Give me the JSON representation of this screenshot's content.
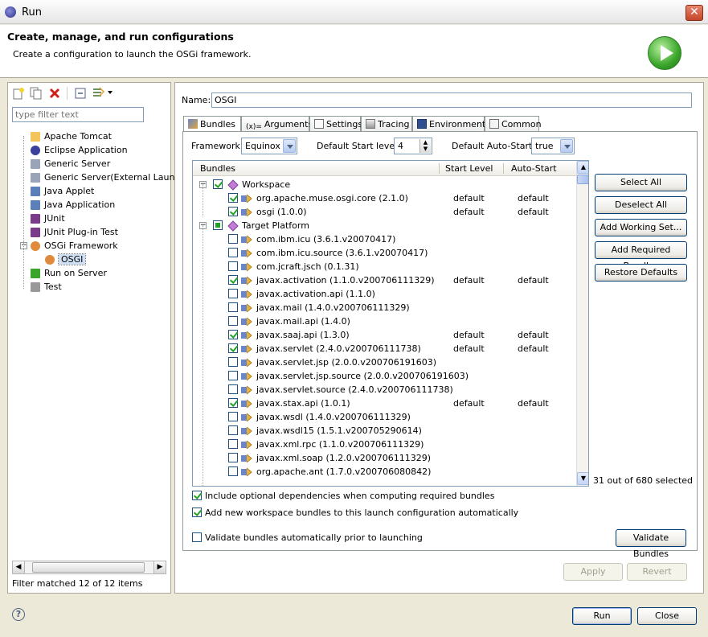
{
  "window": {
    "title": "Run",
    "close_glyph": "✕"
  },
  "header": {
    "title": "Create, manage, and run configurations",
    "description": "Create a configuration to launch the OSGi framework."
  },
  "left": {
    "filter_placeholder": "type filter text",
    "tree": [
      {
        "label": "Apache Tomcat",
        "icon": "tomcat-icon"
      },
      {
        "label": "Eclipse Application",
        "icon": "eclipse-icon"
      },
      {
        "label": "Generic Server",
        "icon": "server-icon"
      },
      {
        "label": "Generic Server(External Launch)",
        "icon": "server-icon"
      },
      {
        "label": "Java Applet",
        "icon": "applet-icon"
      },
      {
        "label": "Java Application",
        "icon": "java-app-icon"
      },
      {
        "label": "JUnit",
        "icon": "junit-icon"
      },
      {
        "label": "JUnit Plug-in Test",
        "icon": "junit-plugin-icon"
      },
      {
        "label": "OSGi Framework",
        "icon": "osgi-icon"
      },
      {
        "label": "OSGI",
        "icon": "osgi-icon"
      },
      {
        "label": "Run on Server",
        "icon": "run-server-icon"
      },
      {
        "label": "Test",
        "icon": "test-icon"
      }
    ],
    "filter_matched": "Filter matched 12 of 12 items"
  },
  "right": {
    "name_label": "Name:",
    "name_value": "OSGI",
    "tabs": [
      "Bundles",
      "Arguments",
      "Settings",
      "Tracing",
      "Environment",
      "Common"
    ],
    "framework_label": "Framework:",
    "framework_value": "Equinox",
    "start_level_label": "Default Start level:",
    "start_level_value": "4",
    "auto_start_label": "Default Auto-Start:",
    "auto_start_value": "true",
    "columns": [
      "Bundles",
      "Start Level",
      "Auto-Start"
    ],
    "rows": [
      {
        "level": 0,
        "expander": "⊟",
        "check": "on",
        "label": "Workspace",
        "sl": "",
        "aa": ""
      },
      {
        "level": 1,
        "check": "on",
        "label": "org.apache.muse.osgi.core (2.1.0)",
        "sl": "default",
        "aa": "default"
      },
      {
        "level": 1,
        "check": "on",
        "label": "osgi (1.0.0)",
        "sl": "default",
        "aa": "default"
      },
      {
        "level": 0,
        "expander": "⊟",
        "check": "part",
        "label": "Target Platform",
        "sl": "",
        "aa": ""
      },
      {
        "level": 1,
        "check": "off",
        "label": "com.ibm.icu (3.6.1.v20070417)",
        "sl": "",
        "aa": ""
      },
      {
        "level": 1,
        "check": "off",
        "label": "com.ibm.icu.source (3.6.1.v20070417)",
        "sl": "",
        "aa": ""
      },
      {
        "level": 1,
        "check": "off",
        "label": "com.jcraft.jsch (0.1.31)",
        "sl": "",
        "aa": ""
      },
      {
        "level": 1,
        "check": "on",
        "label": "javax.activation (1.1.0.v200706111329)",
        "sl": "default",
        "aa": "default"
      },
      {
        "level": 1,
        "check": "off",
        "label": "javax.activation.api (1.1.0)",
        "sl": "",
        "aa": ""
      },
      {
        "level": 1,
        "check": "off",
        "label": "javax.mail (1.4.0.v200706111329)",
        "sl": "",
        "aa": ""
      },
      {
        "level": 1,
        "check": "off",
        "label": "javax.mail.api (1.4.0)",
        "sl": "",
        "aa": ""
      },
      {
        "level": 1,
        "check": "on",
        "label": "javax.saaj.api (1.3.0)",
        "sl": "default",
        "aa": "default"
      },
      {
        "level": 1,
        "check": "on",
        "label": "javax.servlet (2.4.0.v200706111738)",
        "sl": "default",
        "aa": "default"
      },
      {
        "level": 1,
        "check": "off",
        "label": "javax.servlet.jsp (2.0.0.v200706191603)",
        "sl": "",
        "aa": ""
      },
      {
        "level": 1,
        "check": "off",
        "label": "javax.servlet.jsp.source (2.0.0.v200706191603)",
        "sl": "",
        "aa": ""
      },
      {
        "level": 1,
        "check": "off",
        "label": "javax.servlet.source (2.4.0.v200706111738)",
        "sl": "",
        "aa": ""
      },
      {
        "level": 1,
        "check": "on",
        "label": "javax.stax.api (1.0.1)",
        "sl": "default",
        "aa": "default"
      },
      {
        "level": 1,
        "check": "off",
        "label": "javax.wsdl (1.4.0.v200706111329)",
        "sl": "",
        "aa": ""
      },
      {
        "level": 1,
        "check": "off",
        "label": "javax.wsdl15 (1.5.1.v200705290614)",
        "sl": "",
        "aa": ""
      },
      {
        "level": 1,
        "check": "off",
        "label": "javax.xml.rpc (1.1.0.v200706111329)",
        "sl": "",
        "aa": ""
      },
      {
        "level": 1,
        "check": "off",
        "label": "javax.xml.soap (1.2.0.v200706111329)",
        "sl": "",
        "aa": ""
      },
      {
        "level": 1,
        "check": "off",
        "label": "org.apache.ant (1.7.0.v200706080842)",
        "sl": "",
        "aa": ""
      }
    ],
    "buttons": [
      "Select All",
      "Deselect All",
      "Add Working Set...",
      "Add Required Bundles",
      "Restore Defaults"
    ],
    "selected_count": "31 out of 680 selected",
    "options": [
      {
        "label": "Include optional dependencies when computing required bundles",
        "checked": true
      },
      {
        "label": "Add new workspace bundles to this launch configuration automatically",
        "checked": true
      }
    ],
    "validate_option": {
      "label": "Validate bundles automatically prior to launching",
      "checked": false
    },
    "validate_button": "Validate Bundles",
    "apply": "Apply",
    "revert": "Revert"
  },
  "footer": {
    "run": "Run",
    "close": "Close",
    "help_glyph": "?"
  },
  "colors": {
    "accent": "#316ac5",
    "check": "#21a121",
    "run_green": "#3aa52a"
  }
}
